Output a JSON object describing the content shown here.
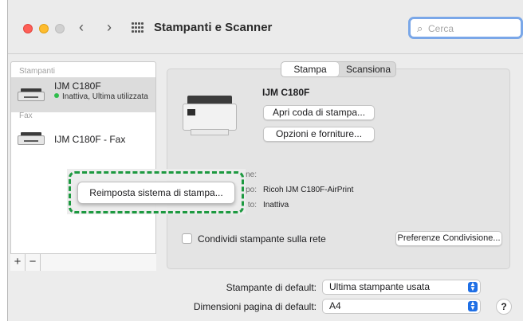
{
  "window": {
    "title": "Stampanti e Scanner",
    "nav_back": "‹",
    "nav_forward": "›",
    "search_placeholder": "Cerca",
    "search_icon": "magnifier-icon"
  },
  "sidebar": {
    "section_printers": "Stampanti",
    "printers": [
      {
        "name": "IJM C180F",
        "status": "Inattiva, Ultima utilizzata",
        "selected": true
      }
    ],
    "section_fax": "Fax",
    "fax": [
      {
        "name": "IJM C180F - Fax"
      }
    ],
    "add_button": "+",
    "remove_button": "−"
  },
  "tabs": {
    "print": "Stampa",
    "scan": "Scansiona",
    "active": "print"
  },
  "detail": {
    "printer_name": "IJM C180F",
    "open_queue_button": "Apri coda di stampa...",
    "options_button": "Opzioni e forniture...",
    "location_label": "one:",
    "kind_label": "po:",
    "kind_value": "Ricoh IJM C180F-AirPrint",
    "status_label": "to:",
    "status_value": "Inattiva",
    "share_checkbox_label": "Condividi stampante sulla rete",
    "share_checked": false,
    "sharing_prefs_button": "Preferenze Condivisione..."
  },
  "footer": {
    "default_printer_label": "Stampante di default:",
    "default_printer_value": "Ultima stampante usata",
    "paper_size_label": "Dimensioni pagina di default:",
    "paper_size_value": "A4",
    "help_button": "?"
  },
  "context_menu": {
    "item": "Reimposta sistema di stampa...",
    "highlight_color": "#1d9940"
  },
  "colors": {
    "accent": "#1f6fe5",
    "status_green": "#2fbd4b",
    "close": "#fe5f57",
    "minimize": "#febc2e"
  }
}
